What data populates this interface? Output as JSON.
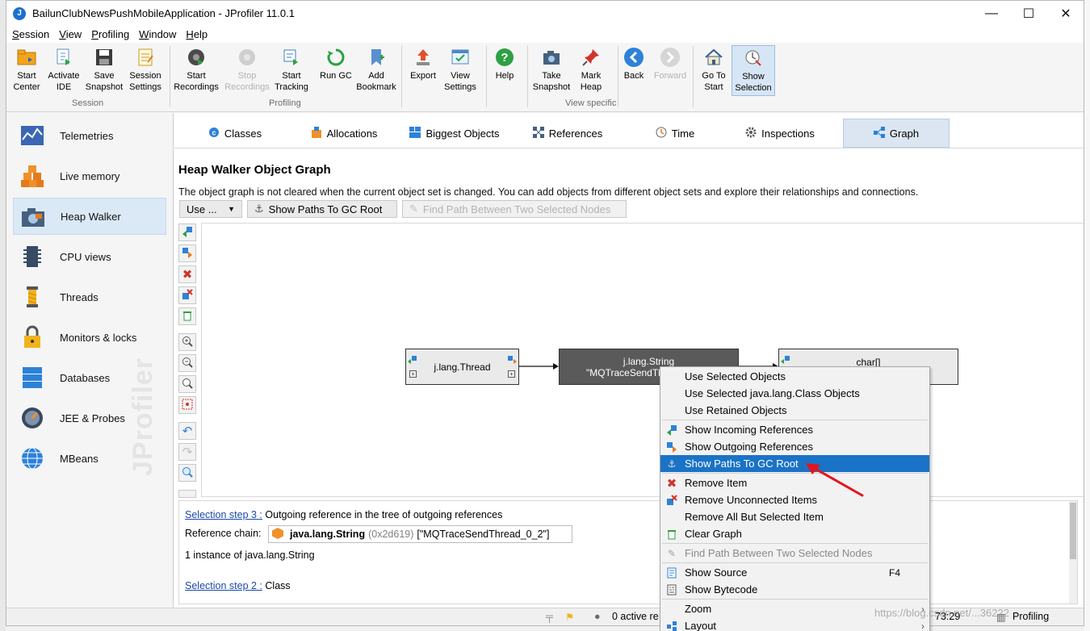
{
  "window": {
    "title": "BailunClubNewsPushMobileApplication - JProfiler 11.0.1",
    "controls": {
      "minimize": "—",
      "maximize": "☐",
      "close": "✕"
    }
  },
  "menubar": [
    {
      "first": "S",
      "rest": "ession"
    },
    {
      "first": "V",
      "rest": "iew"
    },
    {
      "first": "P",
      "rest": "rofiling"
    },
    {
      "first": "W",
      "rest": "indow"
    },
    {
      "first": "H",
      "rest": "elp"
    }
  ],
  "toolbar": {
    "buttons": [
      {
        "line1": "Start",
        "line2": "Center",
        "icon": "folder-icon"
      },
      {
        "line1": "Activate",
        "line2": "IDE",
        "icon": "ide-icon"
      },
      {
        "line1": "Save",
        "line2": "Snapshot",
        "icon": "save-icon"
      },
      {
        "line1": "Session",
        "line2": "Settings",
        "icon": "settings-icon"
      },
      {
        "line1": "Start",
        "line2": "Recordings",
        "icon": "record-icon"
      },
      {
        "line1": "Stop",
        "line2": "Recordings",
        "icon": "stop-icon"
      },
      {
        "line1": "Start",
        "line2": "Tracking",
        "icon": "tracking-icon"
      },
      {
        "line1": "Run GC",
        "line2": "",
        "icon": "gc-icon"
      },
      {
        "line1": "Add",
        "line2": "Bookmark",
        "icon": "bookmark-icon"
      },
      {
        "line1": "Export",
        "line2": "",
        "icon": "export-icon"
      },
      {
        "line1": "View",
        "line2": "Settings",
        "icon": "view-settings-icon"
      },
      {
        "line1": "Help",
        "line2": "",
        "icon": "help-icon"
      },
      {
        "line1": "Take",
        "line2": "Snapshot",
        "icon": "camera-icon"
      },
      {
        "line1": "Mark",
        "line2": "Heap",
        "icon": "pin-icon"
      },
      {
        "line1": "Back",
        "line2": "",
        "icon": "back-icon"
      },
      {
        "line1": "Forward",
        "line2": "",
        "icon": "forward-icon"
      },
      {
        "line1": "Go To",
        "line2": "Start",
        "icon": "home-icon"
      },
      {
        "line1": "Show",
        "line2": "Selection",
        "icon": "selection-icon"
      }
    ],
    "groups": [
      "Session",
      "Profiling",
      "View specific"
    ]
  },
  "sidebar": {
    "items": [
      {
        "label": "Telemetries",
        "icon": "telemetries-icon"
      },
      {
        "label": "Live memory",
        "icon": "live-memory-icon"
      },
      {
        "label": "Heap Walker",
        "icon": "heap-walker-icon"
      },
      {
        "label": "CPU views",
        "icon": "cpu-icon"
      },
      {
        "label": "Threads",
        "icon": "threads-icon"
      },
      {
        "label": "Monitors & locks",
        "icon": "lock-icon"
      },
      {
        "label": "Databases",
        "icon": "database-icon"
      },
      {
        "label": "JEE & Probes",
        "icon": "probe-icon"
      },
      {
        "label": "MBeans",
        "icon": "globe-icon"
      }
    ],
    "active_index": 2,
    "watermark": "JProfiler"
  },
  "tabs": [
    {
      "label": "Classes",
      "icon": "classes-icon"
    },
    {
      "label": "Allocations",
      "icon": "allocations-icon"
    },
    {
      "label": "Biggest Objects",
      "icon": "biggest-objects-icon"
    },
    {
      "label": "References",
      "icon": "references-icon"
    },
    {
      "label": "Time",
      "icon": "time-icon"
    },
    {
      "label": "Inspections",
      "icon": "inspections-icon"
    },
    {
      "label": "Graph",
      "icon": "graph-icon"
    }
  ],
  "view": {
    "title": "Heap Walker Object Graph",
    "description": "The object graph is not cleared when the current object set is changed. You can add objects from different object sets and explore their relationships and connections.",
    "use_button": "Use ...",
    "gc_root_button": "Show Paths To GC Root",
    "find_path_button": "Find Path Between Two Selected Nodes"
  },
  "graph": {
    "nodes": [
      {
        "line1": "j.lang.Thread",
        "line2": ""
      },
      {
        "line1": "j.lang.String",
        "line2": "\"MQTraceSendThr"
      },
      {
        "line1": "char[]",
        "line2": ""
      }
    ]
  },
  "details": {
    "step3_link": "Selection step 3 :",
    "step3_text": "Outgoing reference in the tree of outgoing references",
    "ref_chain_label": "Reference chain:",
    "ref_chain_class": "java.lang.String",
    "ref_chain_id": "(0x2d619)",
    "ref_chain_value": "[\"MQTraceSendThread_0_2\"]",
    "instances": "1 instance of java.lang.String",
    "step2_link": "Selection step 2 :",
    "step2_text": "Class"
  },
  "context_menu": {
    "items": [
      {
        "label": "Use Selected Objects"
      },
      {
        "label": "Use Selected java.lang.Class Objects"
      },
      {
        "label": "Use Retained Objects"
      },
      {
        "label": "Show Incoming References",
        "icon": "incoming-icon"
      },
      {
        "label": "Show Outgoing References",
        "icon": "outgoing-icon"
      },
      {
        "label": "Show Paths To GC Root",
        "icon": "anchor-icon"
      },
      {
        "label": "Remove Item",
        "icon": "remove-icon"
      },
      {
        "label": "Remove Unconnected Items",
        "icon": "remove-unconnected-icon"
      },
      {
        "label": "Remove All But Selected Item"
      },
      {
        "label": "Clear Graph",
        "icon": "clear-icon"
      },
      {
        "label": "Find Path Between Two Selected Nodes",
        "icon": "pencil-icon"
      },
      {
        "label": "Show Source",
        "shortcut": "F4",
        "icon": "source-icon"
      },
      {
        "label": "Show Bytecode",
        "icon": "bytecode-icon"
      },
      {
        "label": "Zoom"
      },
      {
        "label": "Layout",
        "icon": "layout-icon"
      }
    ],
    "highlighted_index": 5,
    "disabled_index": 10,
    "highlight_color": "#1a73c6"
  },
  "statusbar": {
    "active_text": "0 active re",
    "time": "73:29",
    "mode": "Profiling"
  },
  "page_watermark": "https://blog.csdn.net/...36222"
}
